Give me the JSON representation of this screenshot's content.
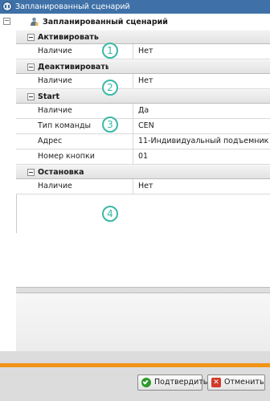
{
  "window": {
    "title": "Запланированный сценарий"
  },
  "tree": {
    "root_label": "Запланированный сценарий"
  },
  "sections": [
    {
      "label": "Активировать",
      "callout": "1",
      "props": [
        {
          "name": "Наличие",
          "value": "Нет"
        }
      ]
    },
    {
      "label": "Деактивировать",
      "callout": "2",
      "props": [
        {
          "name": "Наличие",
          "value": "Нет"
        }
      ]
    },
    {
      "label": "Start",
      "callout": "3",
      "props": [
        {
          "name": "Наличие",
          "value": "Да"
        },
        {
          "name": "Тип команды",
          "value": "CEN"
        },
        {
          "name": "Адрес",
          "value": "11-Индивидуальный подъемник"
        },
        {
          "name": "Номер кнопки",
          "value": "01"
        }
      ]
    },
    {
      "label": "Остановка",
      "callout": "4",
      "props": [
        {
          "name": "Наличие",
          "value": "Нет"
        }
      ]
    }
  ],
  "buttons": {
    "confirm_label": "Подтвердить",
    "cancel_label": "Отменить"
  },
  "colors": {
    "titlebar": "#3f71a8",
    "accent_bar": "#f29418",
    "callout": "#3bb8a6"
  },
  "icons": {
    "app": "app-logo-icon",
    "scenario": "scenario-person-icon",
    "confirm": "checkmark-icon",
    "cancel": "close-icon"
  }
}
